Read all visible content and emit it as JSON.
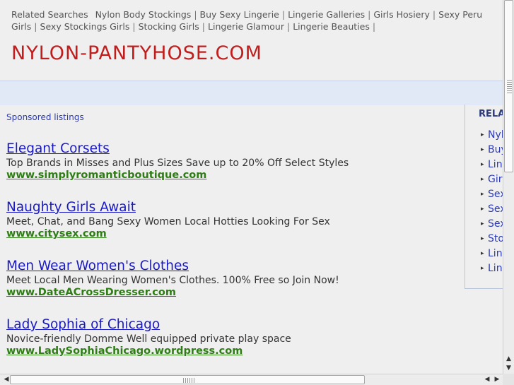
{
  "related_searches": {
    "label": "Related Searches",
    "links": [
      "Nylon Body Stockings",
      "Buy Sexy Lingerie",
      "Lingerie Galleries",
      "Girls Hosiery",
      "Sexy Peru Girls",
      "Sexy Stockings Girls",
      "Stocking Girls",
      "Lingerie Glamour",
      "Lingerie Beauties"
    ],
    "separator": "|"
  },
  "site_title": "NYLON-PANTYHOSE.COM",
  "sponsored_label": "Sponsored listings",
  "ads": [
    {
      "title": "Elegant Corsets",
      "desc": "Top Brands in Misses and Plus Sizes Save up to 20% Off Select Styles",
      "url": "www.simplyromanticboutique.com"
    },
    {
      "title": "Naughty Girls Await",
      "desc": "Meet, Chat, and Bang Sexy Women Local Hotties Looking For Sex",
      "url": "www.citysex.com"
    },
    {
      "title": "Men Wear Women's Clothes",
      "desc": "Meet Local Men Wearing Women's Clothes. 100% Free so Join Now!",
      "url": "www.DateACrossDresser.com"
    },
    {
      "title": "Lady Sophia of Chicago",
      "desc": "Novice-friendly Domme Well equipped private play space",
      "url": "www.LadySophiaChicago.wordpress.com"
    }
  ],
  "sidebar": {
    "heading": "RELA",
    "items": [
      "Nyl",
      "Buy",
      "Lin",
      "Girl",
      "Sex",
      "Sex",
      "Sex",
      "Sto",
      "Lin",
      "Lin"
    ]
  },
  "colors": {
    "title": "#c21d1d",
    "ad_title": "#1a1ac4",
    "ad_url": "#2e7d15",
    "band": "#e1e8f6"
  }
}
